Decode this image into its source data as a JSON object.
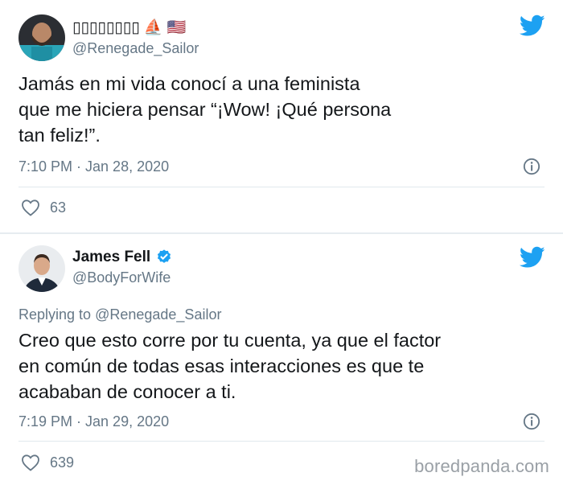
{
  "tweets": [
    {
      "display_name": "▯▯▯▯▯▯▯▯ ⛵ 🇺🇸",
      "handle": "@Renegade_Sailor",
      "text": "Jamás en mi vida conocí a una feminista\nque me hiciera pensar “¡Wow! ¡Qué  persona\ntan feliz!”.",
      "timestamp": "7:10 PM · Jan 28, 2020",
      "likes": "63"
    },
    {
      "display_name": "James Fell",
      "verified": true,
      "handle": "@BodyForWife",
      "replying_label": "Replying to",
      "replying_to": "@Renegade_Sailor",
      "text": "Creo que esto corre por tu cuenta, ya que el factor\nen común de todas esas interacciones es que te\nacababan de conocer a ti.",
      "timestamp": "7:19 PM · Jan 29, 2020",
      "likes": "639"
    }
  ],
  "watermark": "boredpanda.com",
  "colors": {
    "twitter_blue": "#1da1f2",
    "secondary_text": "#657786",
    "primary_text": "#14171a",
    "divider": "#e1e8ed"
  },
  "icons": {
    "brand": "twitter-bird-icon",
    "info": "info-icon",
    "like": "heart-icon",
    "verified": "verified-badge-icon"
  }
}
